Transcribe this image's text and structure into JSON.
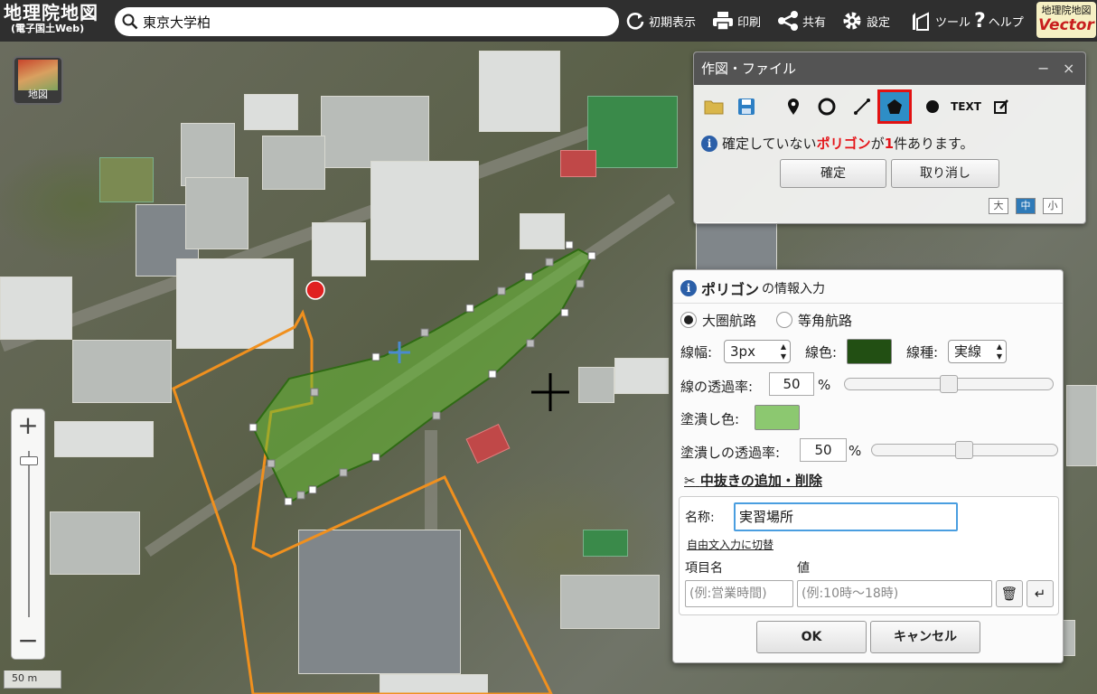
{
  "app": {
    "logo_title": "地理院地図",
    "logo_subtitle": "(電子国土Web)",
    "vector_badge_top": "地理院地図",
    "vector_badge_bottom": "Vector"
  },
  "search": {
    "value": "東京大学柏"
  },
  "toolbar": {
    "items": [
      {
        "label": "初期表示",
        "icon": "reload-icon"
      },
      {
        "label": "印刷",
        "icon": "printer-icon"
      },
      {
        "label": "共有",
        "icon": "share-icon"
      },
      {
        "label": "設定",
        "icon": "gear-icon"
      },
      {
        "label": "ツール",
        "icon": "tools-icon"
      },
      {
        "label": "ヘルプ",
        "icon": "help-icon"
      }
    ]
  },
  "map": {
    "base_map_button": "地図",
    "scale_label": "50 m",
    "zoom_in": "+",
    "zoom_out": "−",
    "polygon_fill_color": "#66bb33",
    "polygon_vertex_color": "#ffffff",
    "orange_outline_color": "#f0901e",
    "marker_color": "#e02020"
  },
  "draw_panel": {
    "title": "作図・ファイル",
    "minimize": "−",
    "close": "×",
    "tools": [
      "open-folder-icon",
      "save-icon",
      "marker-icon",
      "circle-icon",
      "line-icon",
      "polygon-icon",
      "point-icon",
      "text-tool",
      "edit-icon"
    ],
    "text_tool_label": "TEXT",
    "message_pre": "確定していない",
    "message_highlight": "ポリゴン",
    "message_mid": "が",
    "message_count": "1",
    "message_post": "件あります。",
    "confirm_button": "確定",
    "cancel_button": "取り消し",
    "sizes": [
      "大",
      "中",
      "小"
    ],
    "selected_size": "中"
  },
  "polygon_panel": {
    "title_bold": "ポリゴン",
    "title_rest": "の情報入力",
    "route_great_circle": "大圏航路",
    "route_rhumb": "等角航路",
    "line_width_label": "線幅:",
    "line_width_value": "3px",
    "line_color_label": "線色:",
    "line_color": "#224f13",
    "line_type_label": "線種:",
    "line_type_value": "実線",
    "line_opacity_label": "線の透過率:",
    "line_opacity_value": "50",
    "percent": "%",
    "fill_color_label": "塗潰し色:",
    "fill_color": "#8cc870",
    "fill_opacity_label": "塗潰しの透過率:",
    "fill_opacity_value": "50",
    "hole_link": "中抜きの追加・削除",
    "name_label": "名称:",
    "name_value": "実習場所",
    "free_text_link": "自由文入力に切替",
    "item_name_header": "項目名",
    "value_header": "値",
    "item_name_placeholder": "(例:営業時間)",
    "value_placeholder": "(例:10時〜18時)",
    "ok_button": "OK",
    "cancel_button": "キャンセル"
  }
}
